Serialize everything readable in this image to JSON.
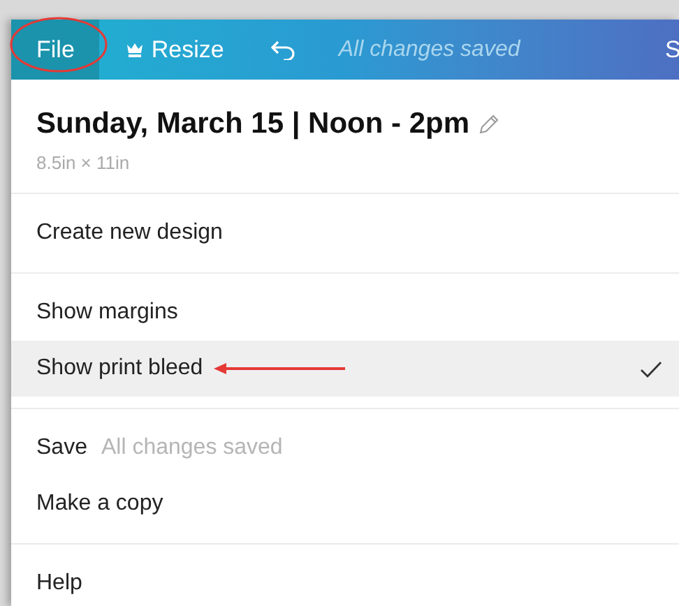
{
  "toolbar": {
    "file": {
      "label": "File",
      "annotated": true
    },
    "resize": {
      "label": "Resize"
    },
    "status": "All changes saved",
    "cut_item": "S"
  },
  "design": {
    "title": "Sunday, March 15 | Noon - 2pm",
    "size": "8.5in × 11in"
  },
  "menu": [
    [
      {
        "kind": "action",
        "label": "Create new design",
        "selected": false,
        "annotated": false
      }
    ],
    [
      {
        "kind": "toggle",
        "label": "Show margins",
        "checked": false,
        "selected": false,
        "annotated": false
      },
      {
        "kind": "toggle",
        "label": "Show print bleed",
        "checked": true,
        "selected": true,
        "annotated": true
      }
    ],
    [
      {
        "kind": "action",
        "label": "Save",
        "note": "All changes saved",
        "selected": false,
        "annotated": false
      },
      {
        "kind": "action",
        "label": "Make a copy",
        "selected": false,
        "annotated": false
      }
    ],
    [
      {
        "kind": "action",
        "label": "Help",
        "selected": false,
        "annotated": false
      }
    ]
  ]
}
